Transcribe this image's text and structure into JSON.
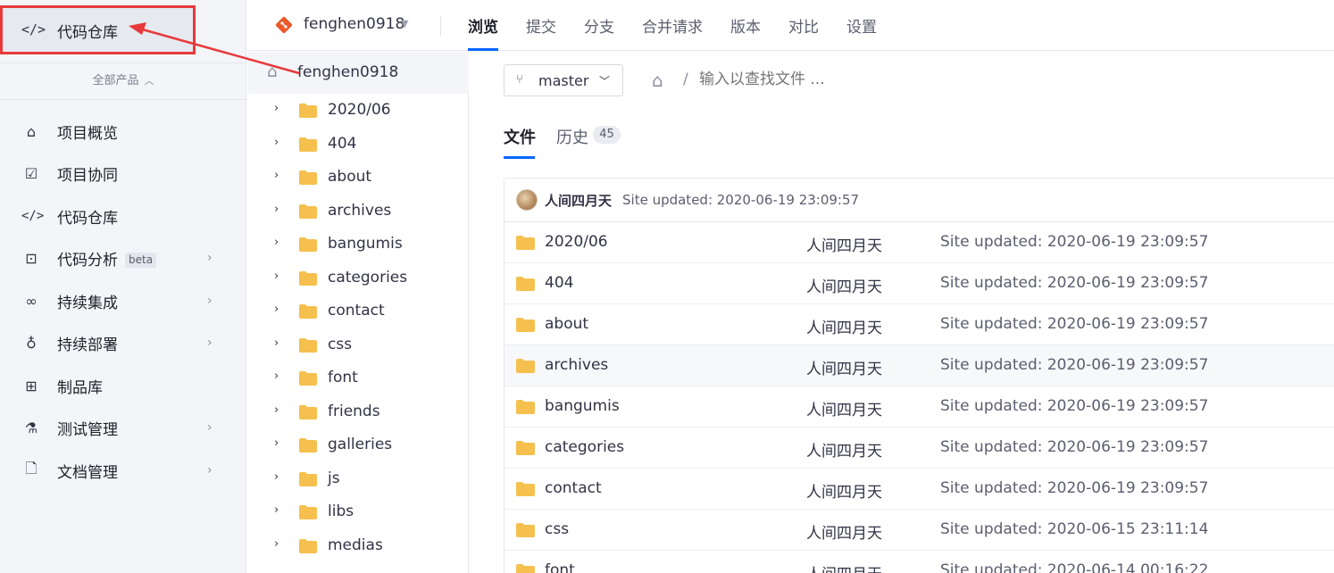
{
  "sidebar": {
    "top": {
      "label": "代码仓库",
      "icon": "code-icon"
    },
    "all_products": "全部产品",
    "items": [
      {
        "label": "项目概览",
        "icon": "home-icon",
        "chevron": false,
        "badge": ""
      },
      {
        "label": "项目协同",
        "icon": "checkbox-icon",
        "chevron": false,
        "badge": ""
      },
      {
        "label": "代码仓库",
        "icon": "code-icon",
        "chevron": false,
        "badge": ""
      },
      {
        "label": "代码分析",
        "icon": "terminal-icon",
        "chevron": true,
        "badge": "beta"
      },
      {
        "label": "持续集成",
        "icon": "infinity-icon",
        "chevron": true,
        "badge": ""
      },
      {
        "label": "持续部署",
        "icon": "rocket-icon",
        "chevron": true,
        "badge": ""
      },
      {
        "label": "制品库",
        "icon": "package-icon",
        "chevron": false,
        "badge": ""
      },
      {
        "label": "测试管理",
        "icon": "flask-icon",
        "chevron": true,
        "badge": ""
      },
      {
        "label": "文档管理",
        "icon": "document-icon",
        "chevron": true,
        "badge": ""
      }
    ]
  },
  "header": {
    "repo_name": "fenghen0918",
    "tabs": [
      {
        "label": "浏览",
        "active": true
      },
      {
        "label": "提交",
        "active": false
      },
      {
        "label": "分支",
        "active": false
      },
      {
        "label": "合并请求",
        "active": false
      },
      {
        "label": "版本",
        "active": false
      },
      {
        "label": "对比",
        "active": false
      },
      {
        "label": "设置",
        "active": false
      }
    ]
  },
  "tree": {
    "root": "fenghen0918",
    "items": [
      "2020/06",
      "404",
      "about",
      "archives",
      "bangumis",
      "categories",
      "contact",
      "css",
      "font",
      "friends",
      "galleries",
      "js",
      "libs",
      "medias"
    ]
  },
  "main": {
    "branch": "master",
    "path_placeholder": "输入以查找文件 ...",
    "path_separator": "/",
    "subtabs": [
      {
        "label": "文件",
        "active": true
      },
      {
        "label": "历史",
        "active": false
      }
    ],
    "history_count": "45",
    "latest_commit": {
      "author": "人间四月天",
      "message": "Site updated: 2020-06-19 23:09:57"
    },
    "files": [
      {
        "name": "2020/06",
        "author": "人间四月天",
        "message": "Site updated: 2020-06-19 23:09:57"
      },
      {
        "name": "404",
        "author": "人间四月天",
        "message": "Site updated: 2020-06-19 23:09:57"
      },
      {
        "name": "about",
        "author": "人间四月天",
        "message": "Site updated: 2020-06-19 23:09:57"
      },
      {
        "name": "archives",
        "author": "人间四月天",
        "message": "Site updated: 2020-06-19 23:09:57"
      },
      {
        "name": "bangumis",
        "author": "人间四月天",
        "message": "Site updated: 2020-06-19 23:09:57"
      },
      {
        "name": "categories",
        "author": "人间四月天",
        "message": "Site updated: 2020-06-19 23:09:57"
      },
      {
        "name": "contact",
        "author": "人间四月天",
        "message": "Site updated: 2020-06-19 23:09:57"
      },
      {
        "name": "css",
        "author": "人间四月天",
        "message": "Site updated: 2020-06-15 23:11:14"
      },
      {
        "name": "font",
        "author": "人间四月天",
        "message": "Site updated: 2020-06-14 00:16:22"
      }
    ]
  },
  "colors": {
    "accent": "#0066ff",
    "annotation": "#e8393b",
    "folder": "#f5c04e",
    "repo_badge": "#ea5a2a"
  }
}
